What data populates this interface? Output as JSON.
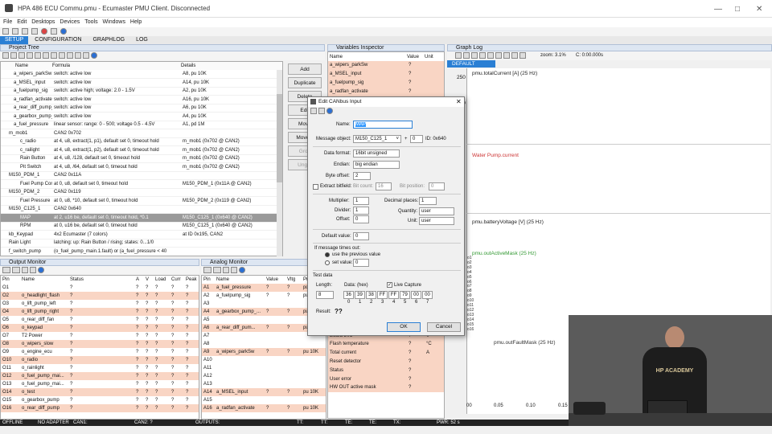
{
  "window": {
    "title": "HPA 486 ECU Commu.pmu - Ecumaster PMU Client. Disconnected"
  },
  "menu": [
    "File",
    "Edit",
    "Desktops",
    "Devices",
    "Tools",
    "Windows",
    "Help"
  ],
  "tabs": [
    "SETUP",
    "CONFIGURATION",
    "GRAPHLOG",
    "LOG"
  ],
  "project_tree": {
    "title": "Project Tree",
    "columns": [
      "Name",
      "Formula",
      "Details"
    ],
    "rows": [
      {
        "name": "a_wipers_parkSw",
        "formula": "switch: active low",
        "details": "A8, pu 10K"
      },
      {
        "name": "a_MSEL_input",
        "formula": "switch: active low",
        "details": "A14, pu 10K"
      },
      {
        "name": "a_fuelpump_sig",
        "formula": "switch: active high; voltage: 2.0 - 1.5V",
        "details": "A2, pu 10K"
      },
      {
        "name": "a_radfan_activate",
        "formula": "switch: active low",
        "details": "A16, pu 10K"
      },
      {
        "name": "a_rear_diff_pump_act",
        "formula": "switch: active low",
        "details": "A6, pu 10K"
      },
      {
        "name": "a_gearbox_pump_activ",
        "formula": "switch: active low",
        "details": "A4, pu 10K"
      },
      {
        "name": "a_fuel_pressure",
        "formula": "linear sensor: range: 0 - 500; voltage 0.5 - 4.5V",
        "details": "A1, pd 1M"
      },
      {
        "name": "m_mob1",
        "formula": "CAN2 0x702",
        "details": ""
      },
      {
        "name": "c_radio",
        "formula": "at 4, u8, extract(1, p1), default set 0, timeout hold",
        "details": "m_mob1 (0x702 @ CAN2)"
      },
      {
        "name": "c_railight",
        "formula": "at 4, u8, extract(1, p2), default set 0, timeout hold",
        "details": "m_mob1 (0x702 @ CAN2)"
      },
      {
        "name": "Rain Button",
        "formula": "at 4, u8, /128, default set 0, timeout hold",
        "details": "m_mob1 (0x702 @ CAN2)"
      },
      {
        "name": "Pit Switch",
        "formula": "at 4, u8, /64, default set 0, timeout hold",
        "details": "m_mob1 (0x702 @ CAN2)"
      },
      {
        "name": "M150_PDM_1",
        "formula": "CAN2 0x11A",
        "details": ""
      },
      {
        "name": "Fuel Pump Contro",
        "formula": "at 0, u8, default set 0, timeout hold",
        "details": "M150_PDM_1 (0x11A @ CAN2)"
      },
      {
        "name": "M150_PDM_2",
        "formula": "CAN2 0x119",
        "details": ""
      },
      {
        "name": "Fuel Pressure",
        "formula": "at 0, u8, *10, default set 0, timeout hold",
        "details": "M150_PDM_2 (0x119 @ CAN2)"
      },
      {
        "name": "M150_C125_1",
        "formula": "CAN2 0x640",
        "details": ""
      },
      {
        "name": "MAP",
        "formula": "at 2, u16 be, default set 0, timeout hold, *0.1",
        "details": "M150_C125_1 (0x640 @ CAN2)"
      },
      {
        "name": "RPM",
        "formula": "at 0, u16 be, default set 0, timeout hold",
        "details": "M150_C125_1 (0x640 @ CAN2)"
      },
      {
        "name": "kb_Keypad",
        "formula": "4x2 Ecumaster (7 colors)",
        "details": "at ID 0x195, CAN2"
      },
      {
        "name": "Rain Light",
        "formula": "latching: up: Rain Button / rising; states: 0...1/0",
        "details": ""
      },
      {
        "name": "f_switch_pump",
        "formula": "(o_fuel_pump_main.1.fault) or (a_fuel_pressure < 40",
        "details": ""
      }
    ]
  },
  "side_buttons": [
    "Add",
    "Duplicate",
    "Delete",
    "Edit",
    "Move",
    "Move d",
    "Grou",
    "Ungro"
  ],
  "variables": {
    "title": "Variables Inspector",
    "columns": [
      "Name",
      "Value",
      "Unit"
    ],
    "rows_top": [
      {
        "name": "a_wipers_parkSw",
        "value": "?",
        "unit": ""
      },
      {
        "name": "a_MSEL_input",
        "value": "?",
        "unit": ""
      },
      {
        "name": "a_fuelpump_sig",
        "value": "?",
        "unit": ""
      },
      {
        "name": "a_radfan_activate",
        "value": "?",
        "unit": ""
      },
      {
        "name": "a_rear_diff_pump_acti",
        "value": "?",
        "unit": ""
      }
    ],
    "rows_bottom": [
      {
        "name": "Board temperature 1",
        "value": "?",
        "unit": "°C"
      },
      {
        "name": "Battery voltage",
        "value": "?",
        "unit": "V"
      },
      {
        "name": "Board temperature 2",
        "value": "?",
        "unit": "°C"
      },
      {
        "name": "5V output",
        "value": "?",
        "unit": "V"
      },
      {
        "name": "Board 3V3",
        "value": "?",
        "unit": "V"
      },
      {
        "name": "Flash temperature",
        "value": "?",
        "unit": "°C"
      },
      {
        "name": "Total current",
        "value": "?",
        "unit": "A"
      },
      {
        "name": "Reset detector",
        "value": "?",
        "unit": ""
      },
      {
        "name": "Status",
        "value": "?",
        "unit": ""
      },
      {
        "name": "User error",
        "value": "?",
        "unit": ""
      },
      {
        "name": "HW OUT active mask",
        "value": "?",
        "unit": ""
      }
    ]
  },
  "graph_log": {
    "title": "Graph Log",
    "zoom": "zoom: 3.1%",
    "cursor": "C: 0:00.000s",
    "default_tab": "DEFAULT",
    "y_tick": "250",
    "y_tick2": "200",
    "labels": [
      "pmu.totalCurrent [A] (25 Hz)",
      "Water Pump.current",
      "pmu.batteryVoltage [V] (25 Hz)",
      "pmu.outActiveMask (25 Hz)",
      "pmu.outFaultMask (25 Hz)"
    ],
    "mask_ticks": [
      "o1",
      "o2",
      "o3",
      "o4",
      "o5",
      "o6",
      "o7",
      "o8",
      "o9",
      "o10",
      "o11",
      "o12",
      "o13",
      "o14",
      "o15",
      "o16"
    ],
    "x_ticks": [
      "00",
      "0.05",
      "0.10",
      "0.15"
    ]
  },
  "output_monitor": {
    "title": "Output Monitor",
    "columns": [
      "Pin",
      "Name",
      "Status",
      "A",
      "V",
      "Load",
      "Curr",
      "Peak"
    ],
    "rows": [
      {
        "pin": "O1",
        "name": "",
        "hl": false
      },
      {
        "pin": "O2",
        "name": "o_headlight_flash",
        "hl": true
      },
      {
        "pin": "O3",
        "name": "o_lift_pump_left",
        "hl": false
      },
      {
        "pin": "O4",
        "name": "o_lift_pump_right",
        "hl": true
      },
      {
        "pin": "O5",
        "name": "o_rear_diff_fan",
        "hl": false
      },
      {
        "pin": "O6",
        "name": "o_keypad",
        "hl": true
      },
      {
        "pin": "O7",
        "name": "T2 Power",
        "hl": false
      },
      {
        "pin": "O8",
        "name": "o_wipers_slow",
        "hl": true
      },
      {
        "pin": "O9",
        "name": "o_engine_ecu",
        "hl": false
      },
      {
        "pin": "O10",
        "name": "o_radio",
        "hl": true
      },
      {
        "pin": "O11",
        "name": "o_rainlight",
        "hl": false
      },
      {
        "pin": "O12",
        "name": "o_fuel_pump_mai...",
        "hl": true
      },
      {
        "pin": "O13",
        "name": "o_fuel_pump_mai...",
        "hl": false
      },
      {
        "pin": "O14",
        "name": "o_test",
        "hl": true
      },
      {
        "pin": "O15",
        "name": "o_gearbox_pump",
        "hl": false
      },
      {
        "pin": "O16",
        "name": "o_rear_diff_pump",
        "hl": true
      }
    ],
    "q": "?"
  },
  "analog_monitor": {
    "title": "Analog Monitor",
    "columns": [
      "Pin",
      "Name",
      "Value",
      "Vltg",
      "Pul"
    ],
    "rows": [
      {
        "pin": "A1",
        "name": "a_fuel_pressure",
        "pull": "pd",
        "hl": true
      },
      {
        "pin": "A2",
        "name": "a_fuelpump_sig",
        "pull": "pu 1",
        "hl": false
      },
      {
        "pin": "A3",
        "name": "",
        "pull": "",
        "hl": false
      },
      {
        "pin": "A4",
        "name": "a_gearbox_pump_...",
        "pull": "pu 1",
        "hl": true
      },
      {
        "pin": "A5",
        "name": "",
        "pull": "",
        "hl": false
      },
      {
        "pin": "A6",
        "name": "a_rear_diff_pum...",
        "pull": "pu 1",
        "hl": true
      },
      {
        "pin": "A7",
        "name": "",
        "pull": "",
        "hl": false
      },
      {
        "pin": "A8",
        "name": "",
        "pull": "",
        "hl": false
      },
      {
        "pin": "A9",
        "name": "a_wipers_parkSw",
        "pull": "pu 10K",
        "hl": true
      },
      {
        "pin": "A10",
        "name": "",
        "pull": "",
        "hl": false
      },
      {
        "pin": "A11",
        "name": "",
        "pull": "",
        "hl": false
      },
      {
        "pin": "A12",
        "name": "",
        "pull": "",
        "hl": false
      },
      {
        "pin": "A13",
        "name": "",
        "pull": "",
        "hl": false
      },
      {
        "pin": "A14",
        "name": "a_MSEL_input",
        "pull": "pu 10K",
        "hl": true
      },
      {
        "pin": "A15",
        "name": "",
        "pull": "",
        "hl": false
      },
      {
        "pin": "A16",
        "name": "a_radfan_activate",
        "pull": "pu 10K",
        "hl": true
      }
    ]
  },
  "dialog": {
    "title": "Edit CANbus Input",
    "name_label": "Name:",
    "name_value": "MAP",
    "msg_obj_label": "Message object:",
    "msg_obj_value": "M150_C125_1",
    "msg_plus": "+",
    "msg_offset": "0",
    "msg_id": "ID: 0x640",
    "data_format_label": "Data format:",
    "data_format_value": "16bit unsigned",
    "endian_label": "Endian:",
    "endian_value": "big endian",
    "byte_offset_label": "Byte offset:",
    "byte_offset_value": "2",
    "extract_label": "Extract bitfield:",
    "bit_count_label": "Bit count:",
    "bit_count_value": "16",
    "bit_pos_label": "Bit position:",
    "bit_pos_value": "0",
    "multiplier_label": "Multiplier:",
    "multiplier_value": "1",
    "divider_label": "Divider:",
    "divider_value": "1",
    "offset_label": "Offset:",
    "offset_value": "0",
    "decimal_label": "Decimal places:",
    "decimal_value": "1",
    "quantity_label": "Quantity:",
    "quantity_value": "user",
    "unit_label": "Unit:",
    "unit_value": "user",
    "default_label": "Default value:",
    "default_value": "0",
    "timeout_label": "If message times out:",
    "use_prev_label": "use the previous value",
    "set_value_label": "set value:",
    "set_value_value": "0",
    "test_label": "Test data",
    "length_label": "Length:",
    "length_value": "8",
    "data_hex_label": "Data: (hex)",
    "live_label": "Live Capture",
    "bytes": [
      "36",
      "39",
      "38",
      "FF",
      "FF",
      "79",
      "00",
      "00"
    ],
    "byte_idx": [
      "0",
      "1",
      "2",
      "3",
      "4",
      "5",
      "6",
      "7"
    ],
    "result_label": "Result:",
    "result_value": "??",
    "ok_label": "OK",
    "cancel_label": "Cancel"
  },
  "statusbar": [
    "OFFLINE",
    "NO ADAPTER",
    "CAN1:",
    "CAN2: ?",
    "OUTPUTS:",
    "TT:",
    "TT:",
    "TE:",
    "TE:",
    "TX:",
    "PWR: 52 s"
  ],
  "video": {
    "caption": "HP ACADEMY"
  }
}
